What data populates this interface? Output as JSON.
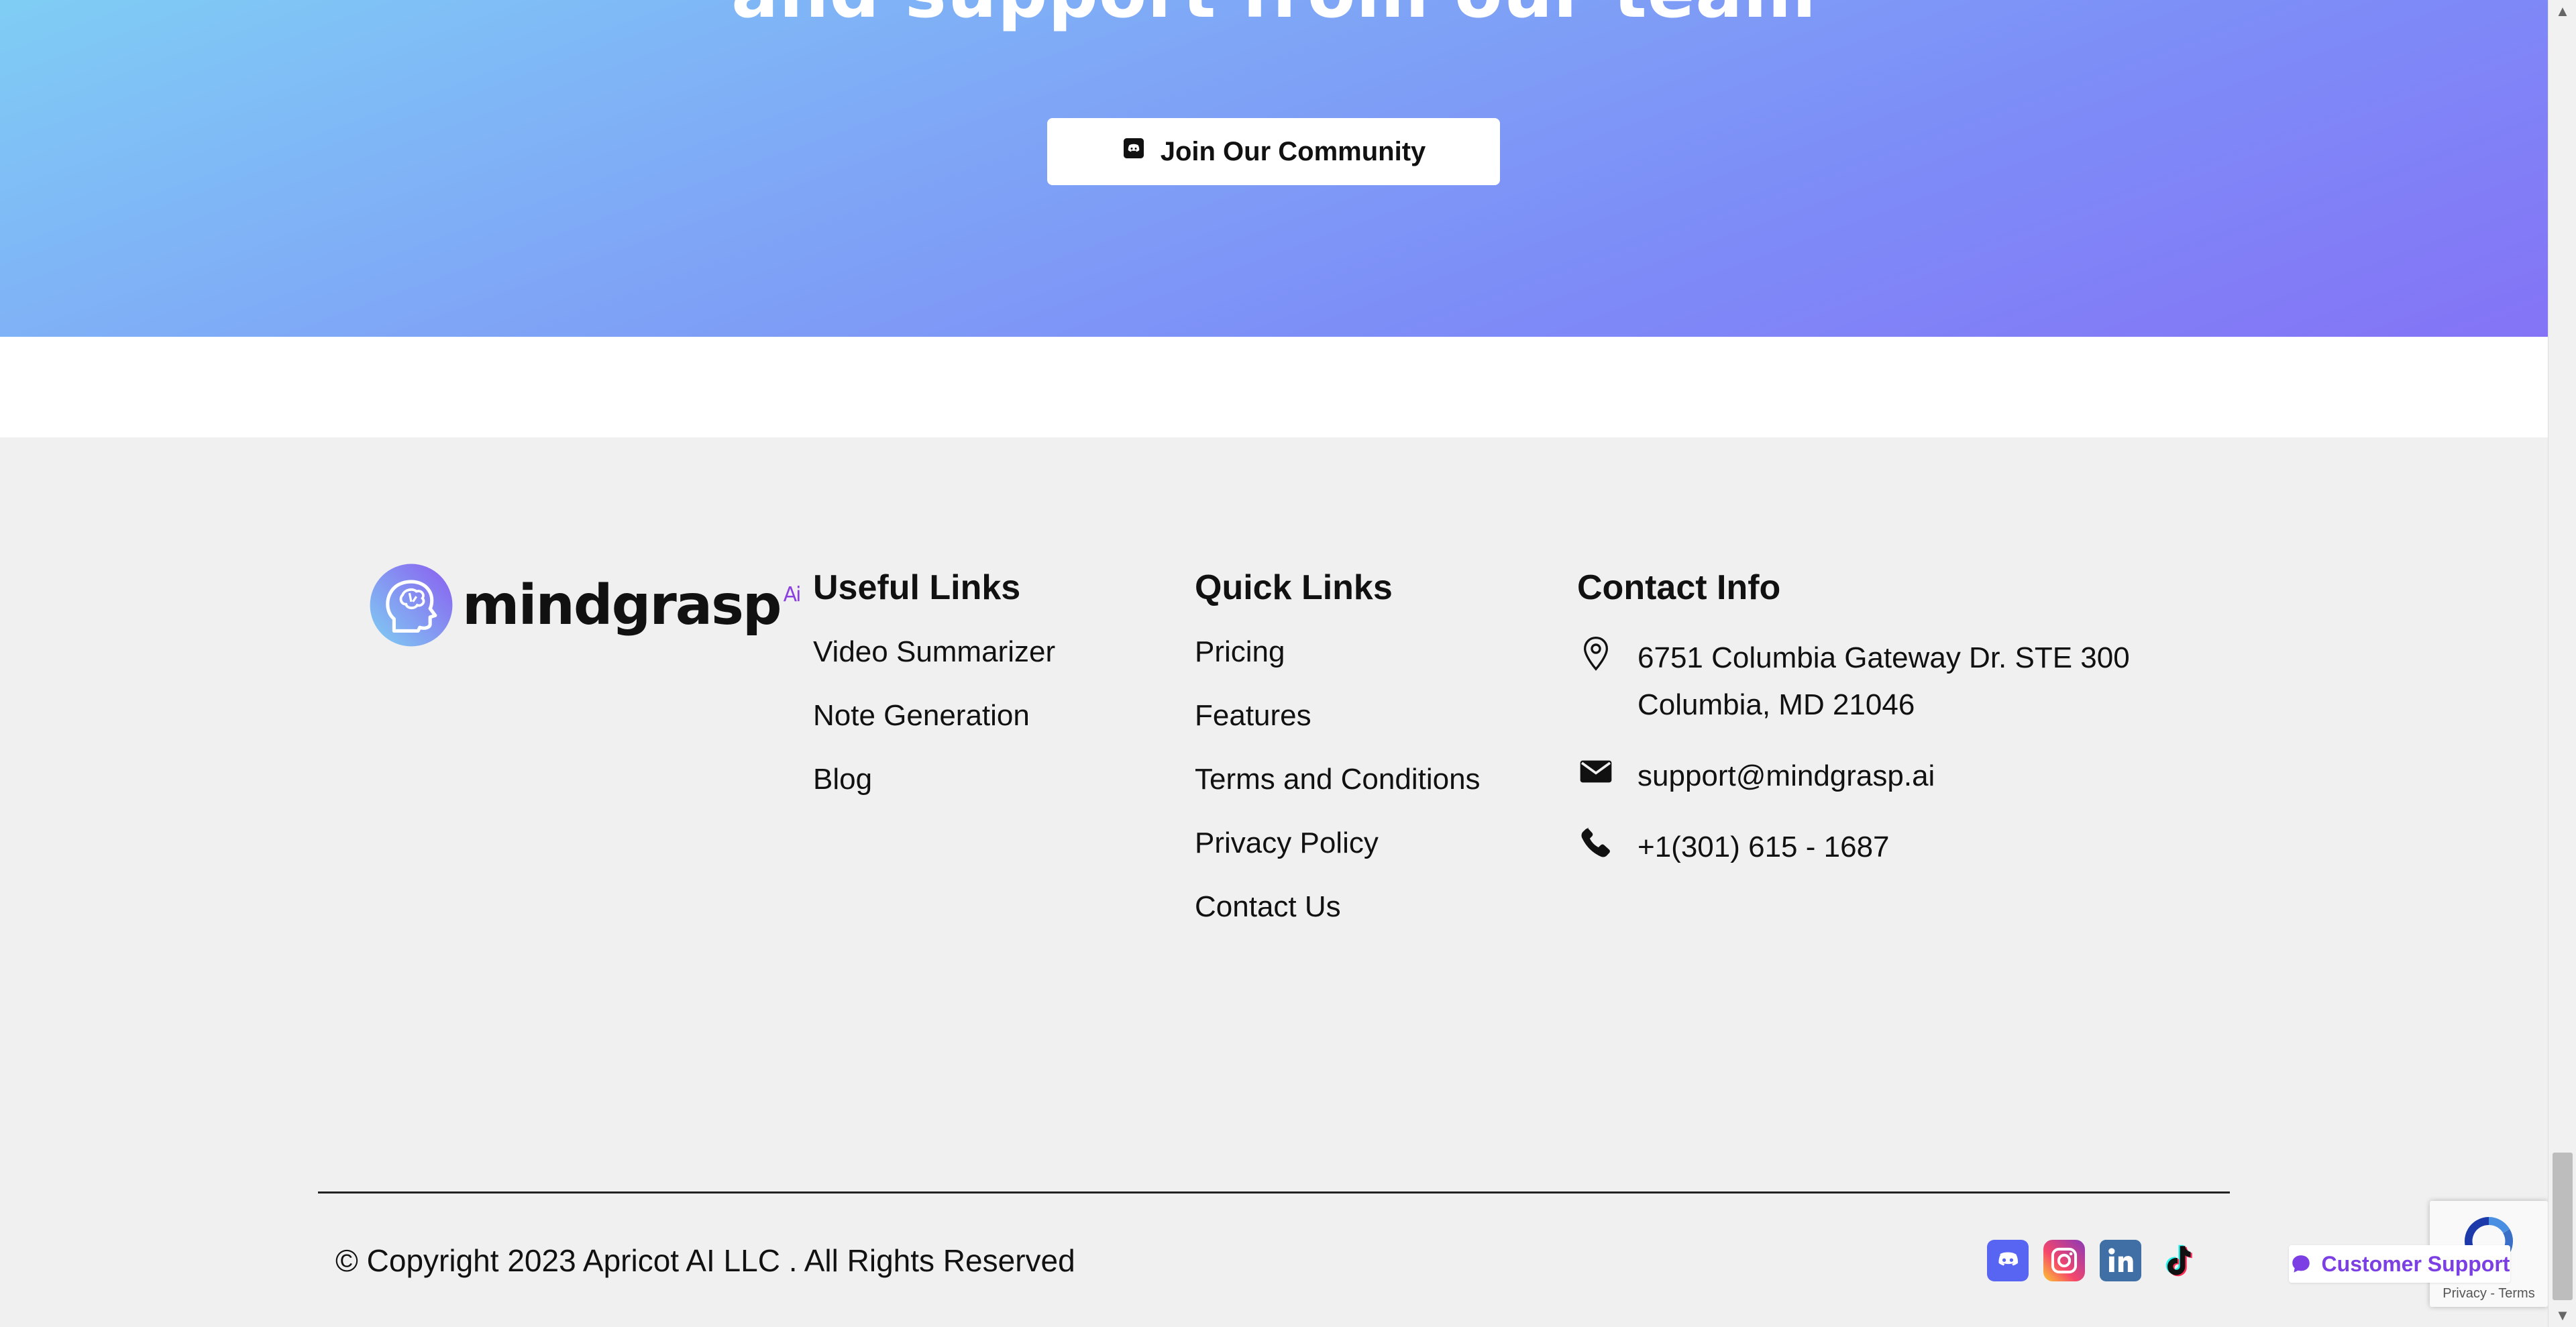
{
  "hero": {
    "title": "and support from our team",
    "join_button": "Join Our Community"
  },
  "footer": {
    "logo": {
      "wordmark": "mindgrasp",
      "superscript": "Ai"
    },
    "useful_links": {
      "heading": "Useful Links",
      "items": [
        "Video Summarizer",
        "Note Generation",
        "Blog"
      ]
    },
    "quick_links": {
      "heading": "Quick Links",
      "items": [
        "Pricing",
        "Features",
        "Terms and Conditions",
        "Privacy Policy",
        "Contact Us"
      ]
    },
    "contact": {
      "heading": "Contact Info",
      "address_line1": "6751 Columbia Gateway Dr. STE 300",
      "address_line2": "Columbia, MD 21046",
      "email": "support@mindgrasp.ai",
      "phone": "+1(301) 615 - 1687"
    },
    "copyright": "© Copyright 2023 Apricot AI LLC . All Rights Reserved",
    "socials": [
      "discord-icon",
      "instagram-icon",
      "linkedin-icon",
      "tiktok-icon"
    ]
  },
  "widgets": {
    "support_label": "Customer Support",
    "recaptcha_links": "Privacy - Terms"
  },
  "colors": {
    "gradient_start": "#7fcdf5",
    "gradient_end": "#8473f6",
    "accent_purple": "#7b3fe4",
    "footer_bg": "#f0f0f0"
  }
}
